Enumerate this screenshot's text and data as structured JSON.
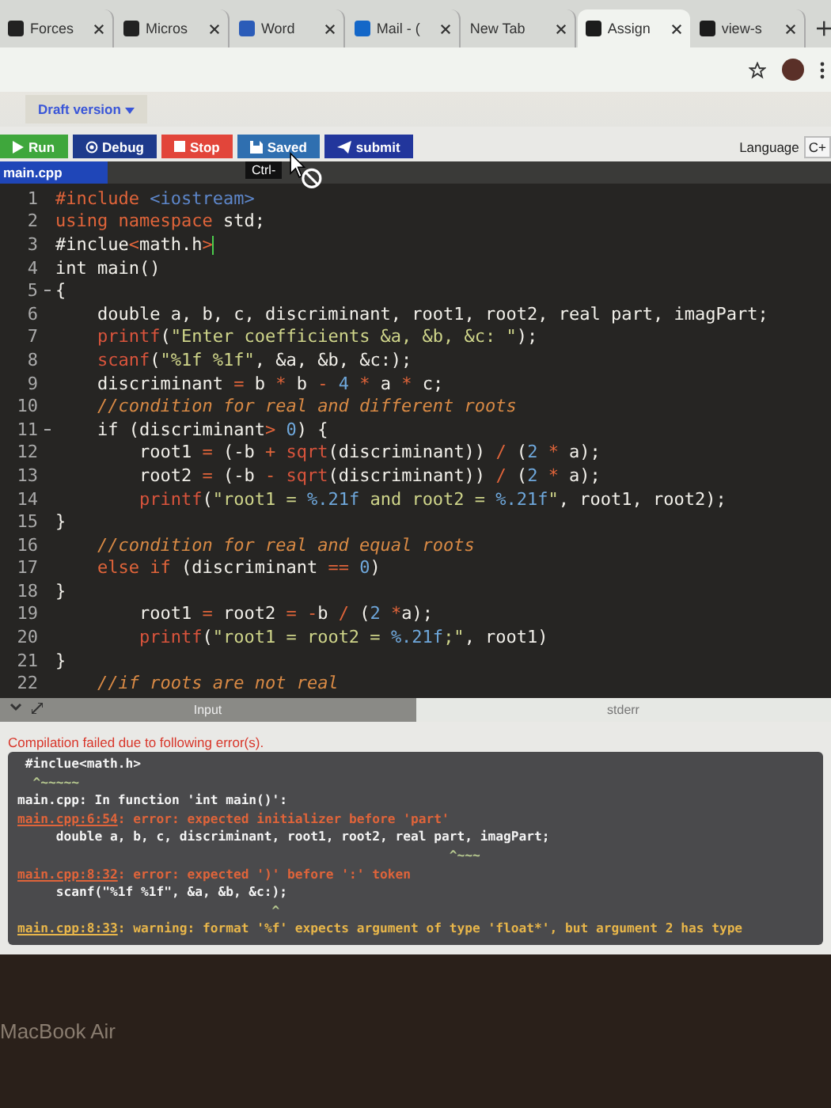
{
  "browser_tabs": [
    {
      "label": "Forces",
      "selected": false
    },
    {
      "label": "Micros",
      "selected": false
    },
    {
      "label": "Word",
      "selected": false
    },
    {
      "label": "Mail - (",
      "selected": false
    },
    {
      "label": "New Tab",
      "selected": false
    },
    {
      "label": "Assign",
      "selected": true
    },
    {
      "label": "view-s",
      "selected": false
    }
  ],
  "version_menu": {
    "label": "Draft version"
  },
  "toolbar_buttons": [
    {
      "kind": "run",
      "label": "Run"
    },
    {
      "kind": "debug",
      "label": "Debug"
    },
    {
      "kind": "stop",
      "label": "Stop"
    },
    {
      "kind": "save",
      "label": "Saved"
    },
    {
      "kind": "submit",
      "label": "submit"
    }
  ],
  "tooltip": "Ctrl-",
  "language": {
    "label": "Language",
    "value": "C+"
  },
  "file_tabs": [
    {
      "label": "main.cpp",
      "selected": true
    }
  ],
  "code_lines": [
    {
      "number": "1",
      "foldable": false,
      "tokens": [
        {
          "kind": "keyword",
          "text": "#include "
        },
        {
          "kind": "include",
          "text": "<iostream>"
        }
      ]
    },
    {
      "number": "2",
      "foldable": false,
      "tokens": [
        {
          "kind": "keyword",
          "text": "using namespace "
        },
        {
          "kind": "plain",
          "text": "std;"
        }
      ]
    },
    {
      "number": "3",
      "foldable": false,
      "cursor": true,
      "tokens": [
        {
          "kind": "plain",
          "text": "#inclue"
        },
        {
          "kind": "operator",
          "text": "<"
        },
        {
          "kind": "plain",
          "text": "math.h"
        },
        {
          "kind": "operator",
          "text": ">"
        }
      ]
    },
    {
      "number": "4",
      "foldable": false,
      "tokens": [
        {
          "kind": "plain",
          "text": "int main()"
        }
      ]
    },
    {
      "number": "5",
      "foldable": true,
      "tokens": [
        {
          "kind": "plain",
          "text": "{"
        }
      ]
    },
    {
      "number": "6",
      "foldable": false,
      "tokens": [
        {
          "kind": "plain",
          "text": "    double a, b, c, discriminant, root1, root2, real part, imagPart;"
        }
      ]
    },
    {
      "number": "7",
      "foldable": false,
      "tokens": [
        {
          "kind": "function",
          "text": "    printf"
        },
        {
          "kind": "plain",
          "text": "("
        },
        {
          "kind": "string",
          "text": "\"Enter coefficients &a, &b, &c: \""
        },
        {
          "kind": "plain",
          "text": ");"
        }
      ]
    },
    {
      "number": "8",
      "foldable": false,
      "tokens": [
        {
          "kind": "function",
          "text": "    scanf"
        },
        {
          "kind": "plain",
          "text": "("
        },
        {
          "kind": "string",
          "text": "\"%1f %1f\""
        },
        {
          "kind": "plain",
          "text": ", &a, &b, &c:);"
        }
      ]
    },
    {
      "number": "9",
      "foldable": false,
      "tokens": [
        {
          "kind": "plain",
          "text": "    discriminant "
        },
        {
          "kind": "operator",
          "text": "="
        },
        {
          "kind": "plain",
          "text": " b "
        },
        {
          "kind": "operator",
          "text": "*"
        },
        {
          "kind": "plain",
          "text": " b "
        },
        {
          "kind": "operator",
          "text": "- "
        },
        {
          "kind": "number",
          "text": "4 "
        },
        {
          "kind": "operator",
          "text": "*"
        },
        {
          "kind": "plain",
          "text": " a "
        },
        {
          "kind": "operator",
          "text": "*"
        },
        {
          "kind": "plain",
          "text": " c;"
        }
      ]
    },
    {
      "number": "10",
      "foldable": false,
      "tokens": [
        {
          "kind": "comment",
          "text": "    //condition for real and different roots"
        }
      ]
    },
    {
      "number": "11",
      "foldable": true,
      "tokens": [
        {
          "kind": "plain",
          "text": "    if (discriminant"
        },
        {
          "kind": "operator",
          "text": "> "
        },
        {
          "kind": "number",
          "text": "0"
        },
        {
          "kind": "plain",
          "text": ") {"
        }
      ]
    },
    {
      "number": "12",
      "foldable": false,
      "tokens": [
        {
          "kind": "plain",
          "text": "        root1 "
        },
        {
          "kind": "operator",
          "text": "="
        },
        {
          "kind": "plain",
          "text": " (-b "
        },
        {
          "kind": "operator",
          "text": "+ "
        },
        {
          "kind": "function",
          "text": "sqrt"
        },
        {
          "kind": "plain",
          "text": "(discriminant)) "
        },
        {
          "kind": "operator",
          "text": "/"
        },
        {
          "kind": "plain",
          "text": " ("
        },
        {
          "kind": "number",
          "text": "2 "
        },
        {
          "kind": "operator",
          "text": "*"
        },
        {
          "kind": "plain",
          "text": " a);"
        }
      ]
    },
    {
      "number": "13",
      "foldable": false,
      "tokens": [
        {
          "kind": "plain",
          "text": "        root2 "
        },
        {
          "kind": "operator",
          "text": "="
        },
        {
          "kind": "plain",
          "text": " (-b "
        },
        {
          "kind": "operator",
          "text": "- "
        },
        {
          "kind": "function",
          "text": "sqrt"
        },
        {
          "kind": "plain",
          "text": "(discriminant)) "
        },
        {
          "kind": "operator",
          "text": "/"
        },
        {
          "kind": "plain",
          "text": " ("
        },
        {
          "kind": "number",
          "text": "2 "
        },
        {
          "kind": "operator",
          "text": "*"
        },
        {
          "kind": "plain",
          "text": " a);"
        }
      ]
    },
    {
      "number": "14",
      "foldable": false,
      "tokens": [
        {
          "kind": "function",
          "text": "        printf"
        },
        {
          "kind": "plain",
          "text": "("
        },
        {
          "kind": "string",
          "text": "\"root1 = "
        },
        {
          "kind": "number",
          "text": "%.21f"
        },
        {
          "kind": "string",
          "text": " and root2 = "
        },
        {
          "kind": "number",
          "text": "%.21f"
        },
        {
          "kind": "string",
          "text": "\""
        },
        {
          "kind": "plain",
          "text": ", root1, root2);"
        }
      ]
    },
    {
      "number": "15",
      "foldable": false,
      "tokens": [
        {
          "kind": "plain",
          "text": "}"
        }
      ]
    },
    {
      "number": "16",
      "foldable": false,
      "tokens": [
        {
          "kind": "comment",
          "text": "    //condition for real and equal roots"
        }
      ]
    },
    {
      "number": "17",
      "foldable": false,
      "tokens": [
        {
          "kind": "keyword",
          "text": "    else if "
        },
        {
          "kind": "plain",
          "text": "(discriminant "
        },
        {
          "kind": "operator",
          "text": "== "
        },
        {
          "kind": "number",
          "text": "0"
        },
        {
          "kind": "plain",
          "text": ")"
        }
      ]
    },
    {
      "number": "18",
      "foldable": false,
      "tokens": [
        {
          "kind": "plain",
          "text": "}"
        }
      ]
    },
    {
      "number": "19",
      "foldable": false,
      "tokens": [
        {
          "kind": "plain",
          "text": "        root1 "
        },
        {
          "kind": "operator",
          "text": "="
        },
        {
          "kind": "plain",
          "text": " root2 "
        },
        {
          "kind": "operator",
          "text": "= -"
        },
        {
          "kind": "plain",
          "text": "b "
        },
        {
          "kind": "operator",
          "text": "/"
        },
        {
          "kind": "plain",
          "text": " ("
        },
        {
          "kind": "number",
          "text": "2 "
        },
        {
          "kind": "operator",
          "text": "*"
        },
        {
          "kind": "plain",
          "text": "a);"
        }
      ]
    },
    {
      "number": "20",
      "foldable": false,
      "tokens": [
        {
          "kind": "function",
          "text": "        printf"
        },
        {
          "kind": "plain",
          "text": "("
        },
        {
          "kind": "string",
          "text": "\"root1 = root2 = "
        },
        {
          "kind": "number",
          "text": "%.21f"
        },
        {
          "kind": "string",
          "text": ";\""
        },
        {
          "kind": "plain",
          "text": ", root1)"
        }
      ]
    },
    {
      "number": "21",
      "foldable": false,
      "tokens": [
        {
          "kind": "plain",
          "text": "}"
        }
      ]
    },
    {
      "number": "22",
      "foldable": false,
      "tokens": [
        {
          "kind": "comment",
          "text": "    //if roots are not real"
        }
      ]
    }
  ],
  "output_tabs": [
    {
      "label": "Input",
      "selected": true
    },
    {
      "label": "stderr",
      "selected": false
    }
  ],
  "status_message": "Compilation failed due to following error(s).",
  "error_lines": [
    {
      "kind": "source",
      "text": " #inclue<math.h>"
    },
    {
      "kind": "marker",
      "text": "  ^~~~~~"
    },
    {
      "kind": "info",
      "text": "main.cpp: In function 'int main()':"
    },
    {
      "kind": "error",
      "location": "main.cpp:6:54",
      "text": ": error: expected initializer before 'part'"
    },
    {
      "kind": "source",
      "text": "     double a, b, c, discriminant, root1, root2, real part, imagPart;"
    },
    {
      "kind": "marker",
      "text": "                                                        ^~~~"
    },
    {
      "kind": "error",
      "location": "main.cpp:8:32",
      "text": ": error: expected ')' before ':' token"
    },
    {
      "kind": "source",
      "text": "     scanf(\"%1f %1f\", &a, &b, &c:);"
    },
    {
      "kind": "marker",
      "text": "                                 ^"
    },
    {
      "kind": "warning",
      "location": "main.cpp:8:33",
      "text": ": warning: format '%f' expects argument of type 'float*', but argument 2 has type"
    }
  ],
  "device_label": "MacBook Air"
}
